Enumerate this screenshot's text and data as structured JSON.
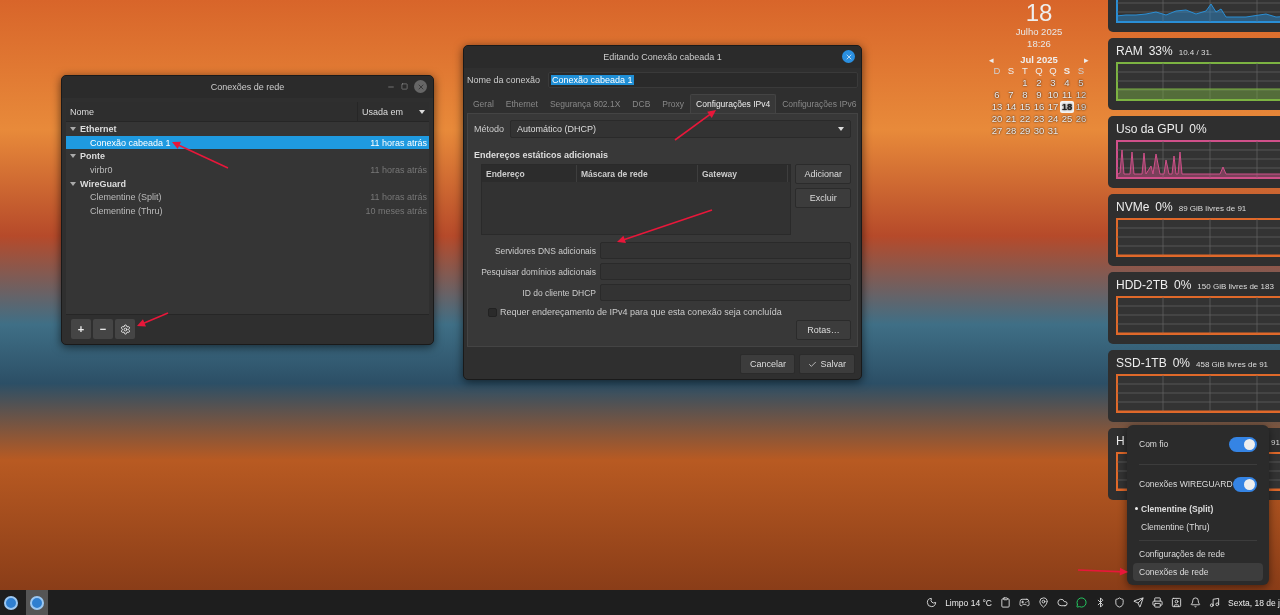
{
  "network_window": {
    "title": "Conexões de rede",
    "columns": [
      "Nome",
      "Usada em"
    ],
    "groups": [
      {
        "label": "Ethernet",
        "expanded": true,
        "children": [
          {
            "name": "Conexão cabeada 1",
            "used": "11 horas atrás",
            "selected": true
          }
        ]
      },
      {
        "label": "Ponte",
        "expanded": true,
        "children": [
          {
            "name": "virbr0",
            "used": "11 horas atrás",
            "selected": false
          }
        ]
      },
      {
        "label": "WireGuard",
        "expanded": true,
        "children": [
          {
            "name": "Clementine (Split)",
            "used": "11 horas atrás",
            "selected": false
          },
          {
            "name": "Clementine (Thru)",
            "used": "10 meses atrás",
            "selected": false
          }
        ]
      }
    ],
    "toolbar": [
      "+",
      "−"
    ]
  },
  "edit_dialog": {
    "title": "Editando Conexão cabeada 1",
    "name_label": "Nome da conexão",
    "name_value": "Conexão cabeada 1",
    "tabs": [
      {
        "label": "Geral",
        "selected": false
      },
      {
        "label": "Ethernet",
        "selected": false
      },
      {
        "label": "Segurança 802.1X",
        "selected": false
      },
      {
        "label": "DCB",
        "selected": false
      },
      {
        "label": "Proxy",
        "selected": false
      },
      {
        "label": "Configurações IPv4",
        "selected": true
      },
      {
        "label": "Configurações IPv6",
        "selected": false
      }
    ],
    "method_label": "Método",
    "method_value": "Automático (DHCP)",
    "section_title": "Endereços estáticos adicionais",
    "table_columns": [
      "Endereço",
      "Máscara de rede",
      "Gateway"
    ],
    "table_buttons": [
      "Adicionar",
      "Excluir"
    ],
    "fields": [
      {
        "label": "Servidores DNS adicionais"
      },
      {
        "label": "Pesquisar domínios adicionais"
      },
      {
        "label": "ID do cliente DHCP"
      }
    ],
    "checkbox": {
      "label": "Requer endereçamento de IPv4 para que esta conexão seja concluída",
      "checked": false
    },
    "routes_button": "Rotas…",
    "cancel_button": "Cancelar",
    "save_button": "Salvar"
  },
  "calendar": {
    "big_day": "18",
    "month_year": "Julho 2025",
    "time": "18:26",
    "prev": "◂",
    "next": "▸",
    "header": "Jul 2025",
    "weekdays": [
      {
        "label": "D",
        "selected": false
      },
      {
        "label": "S",
        "selected": false
      },
      {
        "label": "T",
        "selected": false
      },
      {
        "label": "Q",
        "selected": false
      },
      {
        "label": "Q",
        "selected": false
      },
      {
        "label": "S",
        "selected": true
      },
      {
        "label": "S",
        "selected": false
      }
    ],
    "weeks": [
      [
        {
          "d": "1",
          "selected": false
        },
        {
          "d": "2",
          "selected": false
        },
        {
          "d": "3",
          "selected": false
        },
        {
          "d": "4",
          "selected": false
        },
        {
          "d": "5",
          "selected": false
        }
      ],
      [
        {
          "d": "6",
          "selected": false
        },
        {
          "d": "7",
          "selected": false
        },
        {
          "d": "8",
          "selected": false
        },
        {
          "d": "9",
          "selected": false
        },
        {
          "d": "10",
          "selected": false
        },
        {
          "d": "11",
          "selected": false
        },
        {
          "d": "12",
          "selected": false
        }
      ],
      [
        {
          "d": "13",
          "selected": false
        },
        {
          "d": "14",
          "selected": false
        },
        {
          "d": "15",
          "selected": false
        },
        {
          "d": "16",
          "selected": false
        },
        {
          "d": "17",
          "selected": false
        },
        {
          "d": "18",
          "selected": true
        },
        {
          "d": "19",
          "selected": false
        }
      ],
      [
        {
          "d": "20",
          "selected": false
        },
        {
          "d": "21",
          "selected": false
        },
        {
          "d": "22",
          "selected": false
        },
        {
          "d": "23",
          "selected": false
        },
        {
          "d": "24",
          "selected": false
        },
        {
          "d": "25",
          "selected": false
        },
        {
          "d": "26",
          "selected": false
        }
      ],
      [
        {
          "d": "27",
          "selected": false
        },
        {
          "d": "28",
          "selected": false
        },
        {
          "d": "29",
          "selected": false
        },
        {
          "d": "30",
          "selected": false
        },
        {
          "d": "31",
          "selected": false
        }
      ]
    ]
  },
  "monitors": [
    {
      "kind": "cpu"
    },
    {
      "kind": "ram",
      "label": "RAM",
      "percent": "33%",
      "info": "10.4 / 31."
    },
    {
      "kind": "gpu",
      "label": "Uso da GPU",
      "percent": "0%"
    },
    {
      "kind": "disk",
      "label": "NVMe",
      "percent": "0%",
      "info": "89 GiB livres de 91"
    },
    {
      "kind": "disk",
      "label": "HDD-2TB",
      "percent": "0%",
      "info": "150 GiB livres de 183"
    },
    {
      "kind": "disk",
      "label": "SSD-1TB",
      "percent": "0%",
      "info": "458 GiB livres de 91"
    },
    {
      "kind": "disk",
      "label": "H",
      "info": "91"
    }
  ],
  "network_menu": {
    "items": [
      {
        "kind": "toggle",
        "label": "Com fio",
        "on": true
      },
      {
        "kind": "separator"
      },
      {
        "kind": "toggle",
        "label": "Conexões WIREGUARD",
        "on": true
      },
      {
        "kind": "radio",
        "label": "Clementine (Split)",
        "selected": true
      },
      {
        "kind": "radio",
        "label": "Clementine (Thru)",
        "selected": false
      },
      {
        "kind": "separator"
      },
      {
        "kind": "link",
        "label": "Configurações de rede",
        "selected": false
      },
      {
        "kind": "link",
        "label": "Conexões de rede",
        "selected": true
      }
    ]
  },
  "taskbar": {
    "apps": [
      {
        "selected": false
      },
      {
        "selected": true
      }
    ],
    "weather": "Limpo 14 °C",
    "clock": "Sexta, 18 de j"
  }
}
